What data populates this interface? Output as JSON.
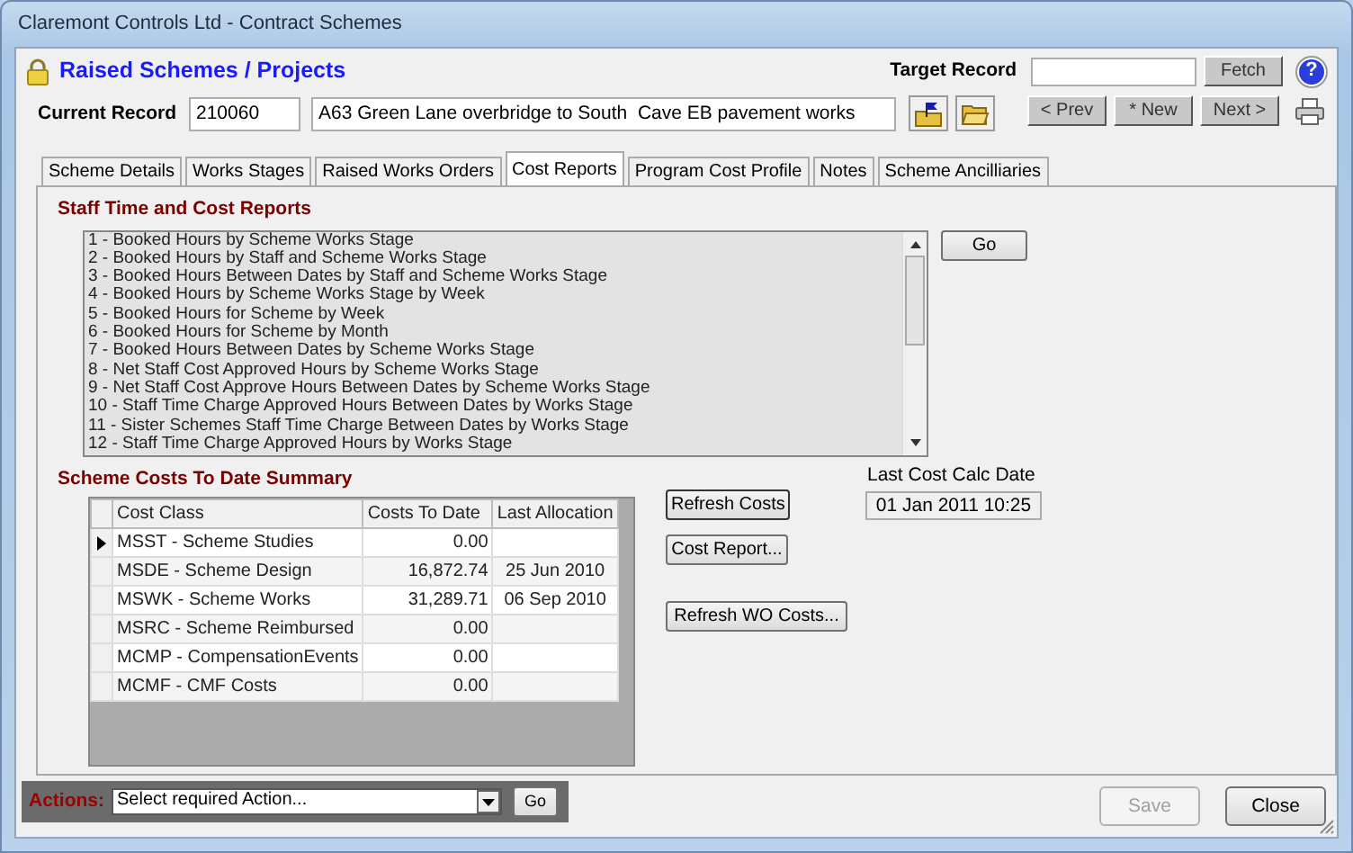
{
  "window": {
    "title": "Claremont Controls Ltd - Contract Schemes"
  },
  "header": {
    "title": "Raised Schemes / Projects"
  },
  "current_record": {
    "label": "Current Record",
    "id": "210060",
    "description": "A63 Green Lane overbridge to South  Cave EB pavement works"
  },
  "target_record": {
    "label": "Target Record",
    "fetch_button": "Fetch",
    "help_button": "?"
  },
  "nav_buttons": [
    {
      "label": "< Prev"
    },
    {
      "label": "* New"
    },
    {
      "label": "Next >"
    }
  ],
  "tabs": [
    {
      "label": "Scheme Details",
      "selected": false
    },
    {
      "label": "Works Stages",
      "selected": false
    },
    {
      "label": "Raised Works Orders",
      "selected": false
    },
    {
      "label": "Cost Reports",
      "selected": true
    },
    {
      "label": "Program Cost Profile",
      "selected": false
    },
    {
      "label": "Notes",
      "selected": false
    },
    {
      "label": "Scheme Ancilliaries",
      "selected": false
    }
  ],
  "staff_reports": {
    "title": "Staff Time and Cost Reports",
    "go_button": "Go",
    "items": [
      "1 - Booked Hours by Scheme Works Stage",
      "2 - Booked Hours by Staff and Scheme Works Stage",
      "3 - Booked Hours Between Dates by Staff and Scheme Works Stage",
      "4 - Booked Hours by Scheme Works Stage by Week",
      "5 - Booked Hours for Scheme by Week",
      "6 - Booked Hours for Scheme by Month",
      "7 - Booked Hours Between Dates by Scheme Works Stage",
      "8 - Net Staff Cost Approved Hours by Scheme Works Stage",
      "9 - Net Staff Cost Approve Hours Between Dates by Scheme Works Stage",
      "10 - Staff Time Charge Approved Hours Between Dates by Works Stage",
      "11 - Sister Schemes Staff Time Charge Between Dates by Works Stage",
      "12 - Staff Time Charge Approved Hours by Works Stage"
    ]
  },
  "summary": {
    "title": "Scheme Costs To Date Summary",
    "columns": [
      "Cost Class",
      "Costs To Date",
      "Last Allocation"
    ],
    "rows": [
      {
        "cost_class": "MSST - Scheme Studies",
        "costs_to_date": "0.00",
        "last_allocation": "",
        "current": true
      },
      {
        "cost_class": "MSDE - Scheme Design",
        "costs_to_date": "16,872.74",
        "last_allocation": "25 Jun 2010",
        "current": false
      },
      {
        "cost_class": "MSWK - Scheme Works",
        "costs_to_date": "31,289.71",
        "last_allocation": "06 Sep 2010",
        "current": false
      },
      {
        "cost_class": "MSRC - Scheme Reimbursed",
        "costs_to_date": "0.00",
        "last_allocation": "",
        "current": false
      },
      {
        "cost_class": "MCMP - CompensationEvents",
        "costs_to_date": "0.00",
        "last_allocation": "",
        "current": false
      },
      {
        "cost_class": "MCMF - CMF Costs",
        "costs_to_date": "0.00",
        "last_allocation": "",
        "current": false
      }
    ]
  },
  "cost_buttons": [
    "Refresh Costs",
    "Cost Report...",
    "Refresh WO Costs..."
  ],
  "last_cost_calc": {
    "label": "Last Cost Calc Date",
    "value": "01 Jan 2011 10:25"
  },
  "actions": {
    "label": "Actions:",
    "value": "Select required Action...",
    "go_button": "Go"
  },
  "footer_buttons": [
    {
      "label": "Save",
      "disabled": true
    },
    {
      "label": "Close",
      "disabled": false
    }
  ]
}
